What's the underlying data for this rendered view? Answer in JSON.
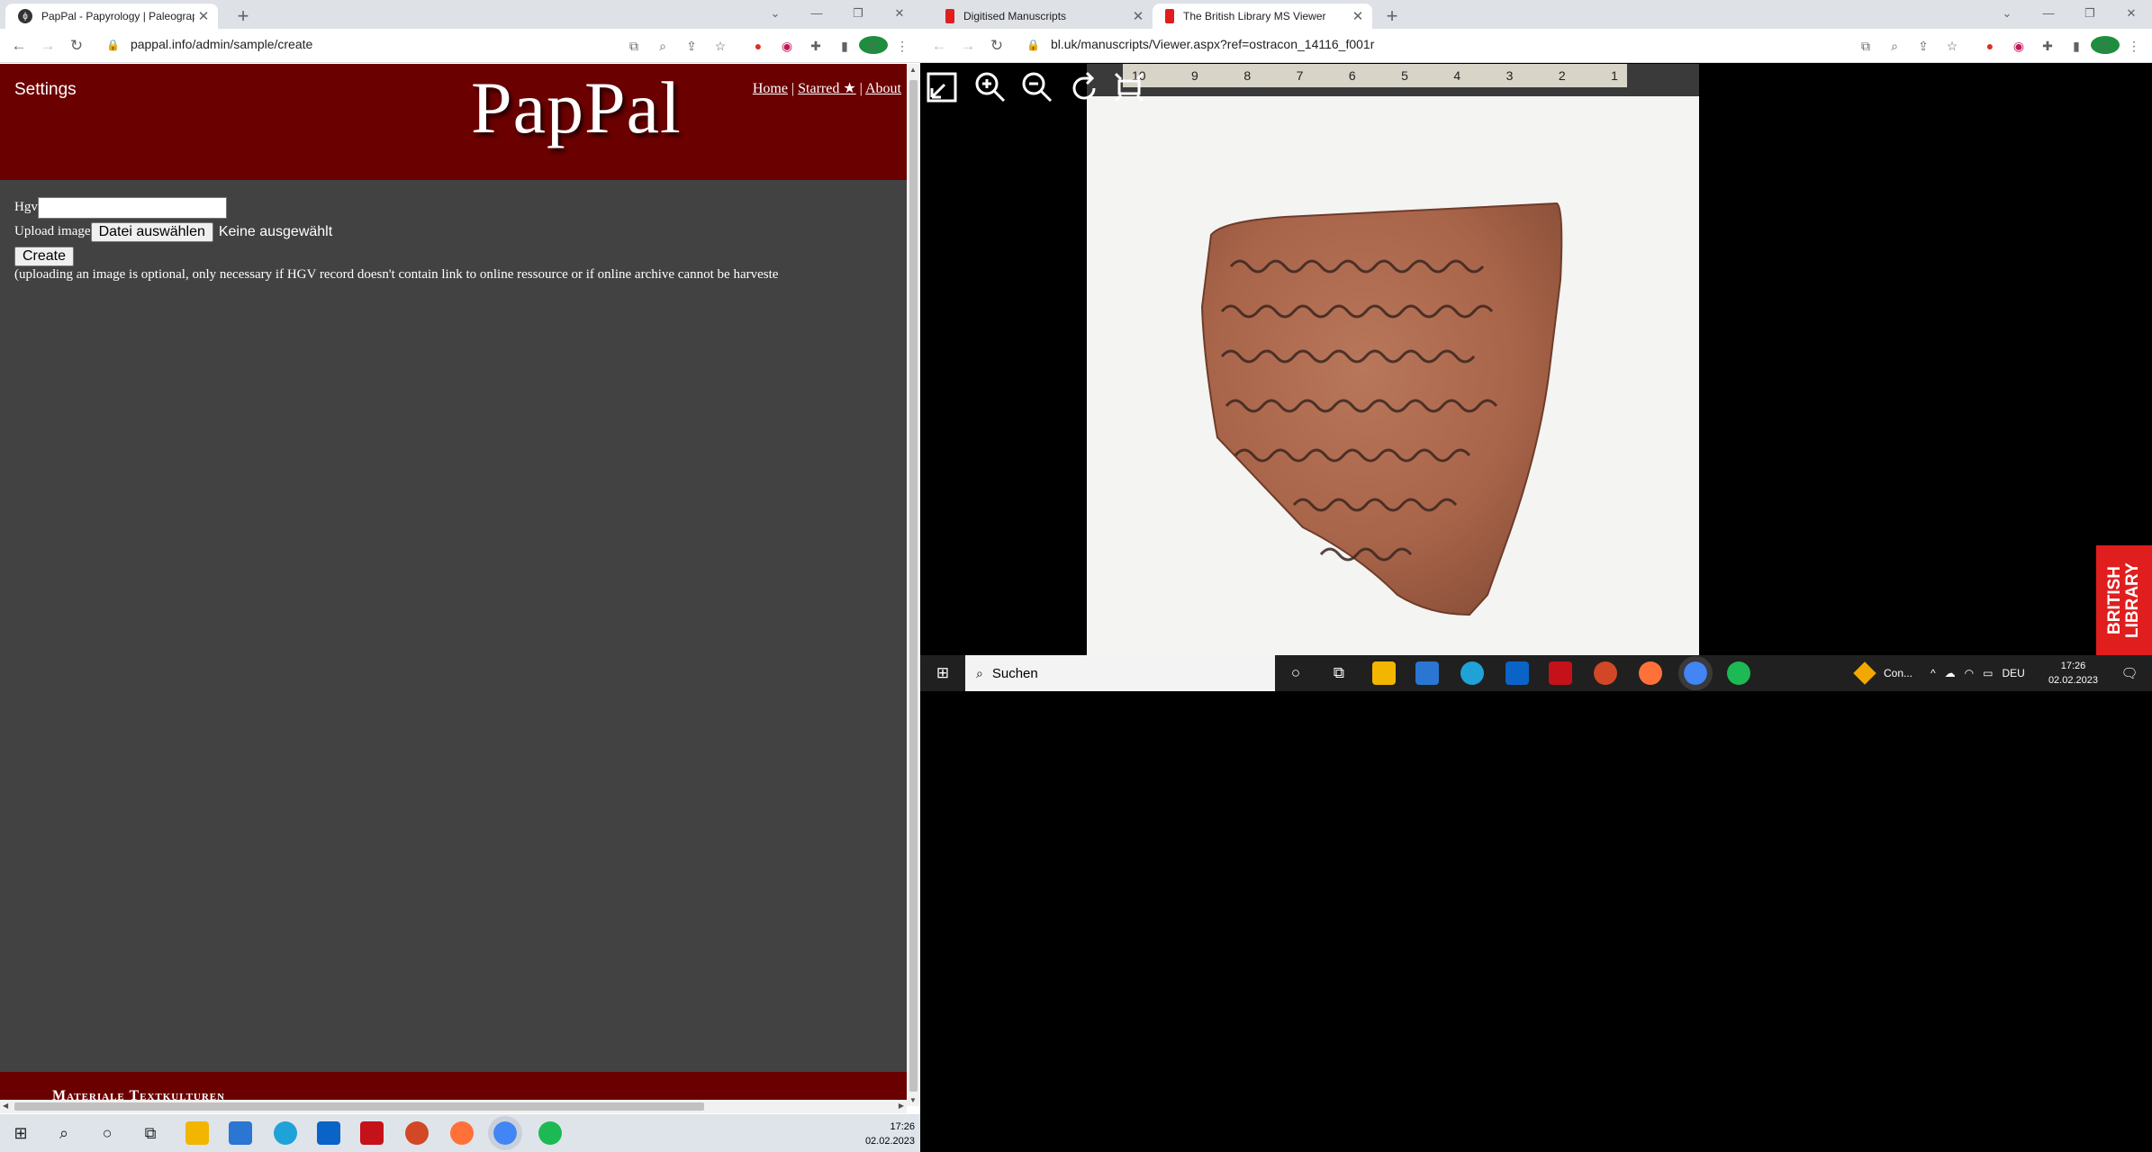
{
  "left_window": {
    "tabs": [
      {
        "title": "PapPal - Papyrology | Paleograph",
        "active": true
      }
    ],
    "url": "pappal.info/admin/sample/create",
    "page": {
      "settings_label": "Settings",
      "logo": "PapPal",
      "nav": {
        "home": "Home",
        "sep1": "|",
        "starred": "Starred ★",
        "sep2": "|",
        "about": "About"
      },
      "form": {
        "hgv_label": "Hgv",
        "hgv_value": "",
        "upload_label": "Upload image",
        "file_button": "Datei auswählen",
        "no_file": "Keine ausgewählt",
        "create_button": "Create",
        "hint": "(uploading an image is optional, only necessary if HGV record doesn't contain link to online ressource or if online archive cannot be harveste"
      },
      "footer_text": "Materiale Textkulturen"
    },
    "taskbar": {
      "time": "17:26",
      "date": "02.02.2023"
    }
  },
  "right_window": {
    "tabs": [
      {
        "title": "Digitised Manuscripts",
        "active": false
      },
      {
        "title": "The British Library MS Viewer",
        "active": true
      }
    ],
    "url": "bl.uk/manuscripts/Viewer.aspx?ref=ostracon_14116_f001r",
    "ruler_numbers": [
      "10",
      "9",
      "8",
      "7",
      "6",
      "5",
      "4",
      "3",
      "2",
      "1"
    ],
    "badge": "BRITISH LIBRARY",
    "taskbar": {
      "search_placeholder": "Suchen",
      "tray_app": "Con...",
      "language": "DEU",
      "time": "17:26",
      "date": "02.02.2023"
    }
  },
  "colors": {
    "pappal_header": "#6b0000",
    "pappal_body": "#424242",
    "chrome_tabbar": "#dee1e6",
    "bl_badge": "#e01e1e"
  }
}
